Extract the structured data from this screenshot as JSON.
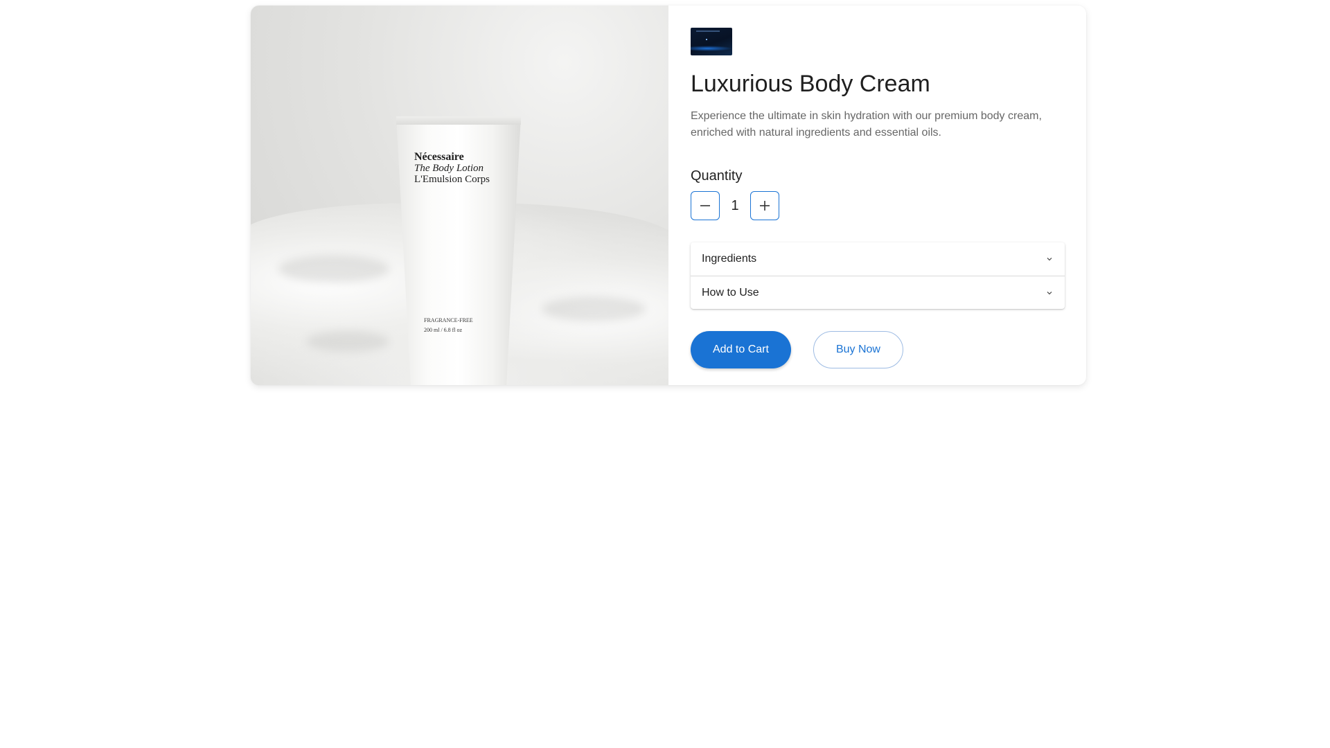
{
  "product": {
    "title": "Luxurious Body Cream",
    "description": "Experience the ultimate in skin hydration with our premium body cream, enriched with natural ingredients and essential oils.",
    "image_alt": "Nécessaire The Body Lotion tube on white fabric",
    "tube_label": {
      "brand": "Nécessaire",
      "line1": "The Body Lotion",
      "line2": "L'Emulsion Corps",
      "small1": "FRAGRANCE-FREE",
      "small2": "200 ml / 6.8 fl oz"
    }
  },
  "quantity": {
    "label": "Quantity",
    "value": "1",
    "decrement_icon": "minus-icon",
    "increment_icon": "plus-icon"
  },
  "accordion": {
    "items": [
      {
        "label": "Ingredients",
        "icon": "chevron-down-icon"
      },
      {
        "label": "How to Use",
        "icon": "chevron-down-icon"
      }
    ]
  },
  "actions": {
    "add_to_cart": "Add to Cart",
    "buy_now": "Buy Now"
  },
  "colors": {
    "accent": "#1a73d4",
    "text": "#1f1f1f",
    "muted": "#666666"
  }
}
